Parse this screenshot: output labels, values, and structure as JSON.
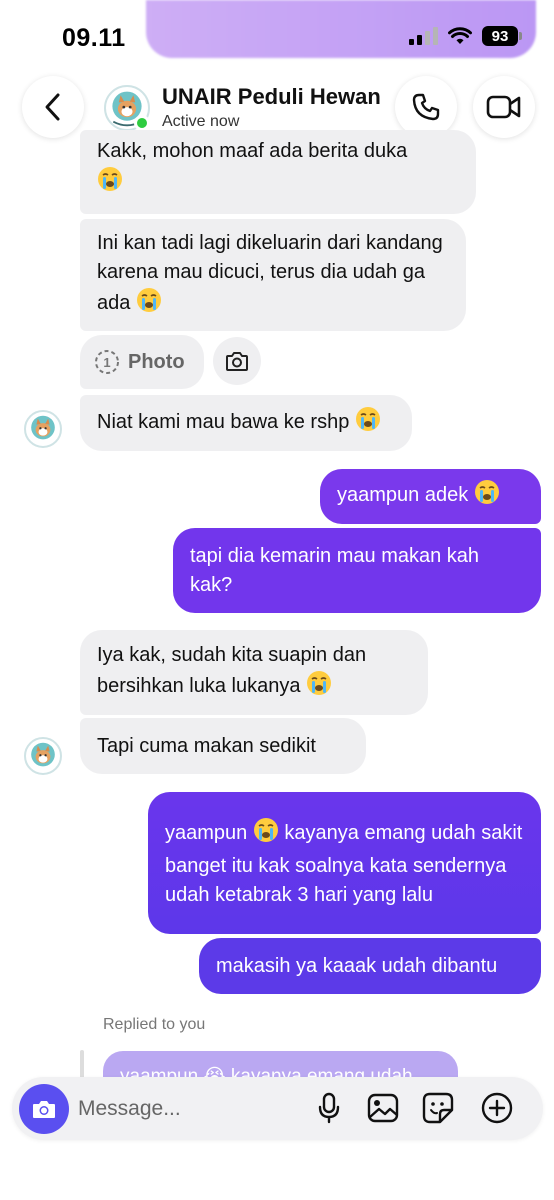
{
  "status_bar": {
    "time": "09.11",
    "battery": "93"
  },
  "header": {
    "contact_name": "UNAIR Peduli Hewan",
    "contact_status": "Active now"
  },
  "messages": [
    {
      "side": "in",
      "text": "Kakk, mohon maaf ada berita duka",
      "emoji": "crying-face"
    },
    {
      "side": "in",
      "text": "Ini kan tadi lagi dikeluarin dari kandang karena mau dicuci, terus dia udah ga ada",
      "emoji": "crying-face"
    },
    {
      "side": "in",
      "type": "view-once-photo",
      "text": "Photo",
      "count": "1"
    },
    {
      "side": "in",
      "text": "Niat kami mau bawa ke rshp",
      "emoji": "crying-face"
    },
    {
      "side": "out",
      "text": "yaampun adek",
      "emoji": "crying-face"
    },
    {
      "side": "out",
      "text": "tapi dia kemarin mau makan kah kak?"
    },
    {
      "side": "in",
      "text": "Iya kak, sudah kita suapin dan bersihkan luka lukanya",
      "emoji": "crying-face"
    },
    {
      "side": "in",
      "text": "Tapi cuma makan sedikit"
    },
    {
      "side": "out",
      "text_before": "yaampun",
      "text": "kayanya emang udah sakit banget itu kak soalnya kata sendernya udah ketabrak 3 hari yang lalu",
      "emoji": "crying-face"
    },
    {
      "side": "out",
      "text": "makasih ya kaaak udah dibantu"
    }
  ],
  "reply": {
    "label": "Replied to you",
    "preview": "yaampun 😭 kayanya emang udah"
  },
  "composer": {
    "placeholder": "Message..."
  },
  "colors": {
    "outgoing": "#7236ec",
    "incoming": "#efeff1",
    "online": "#2ecc40",
    "camera_button": "#5a4ff0"
  }
}
